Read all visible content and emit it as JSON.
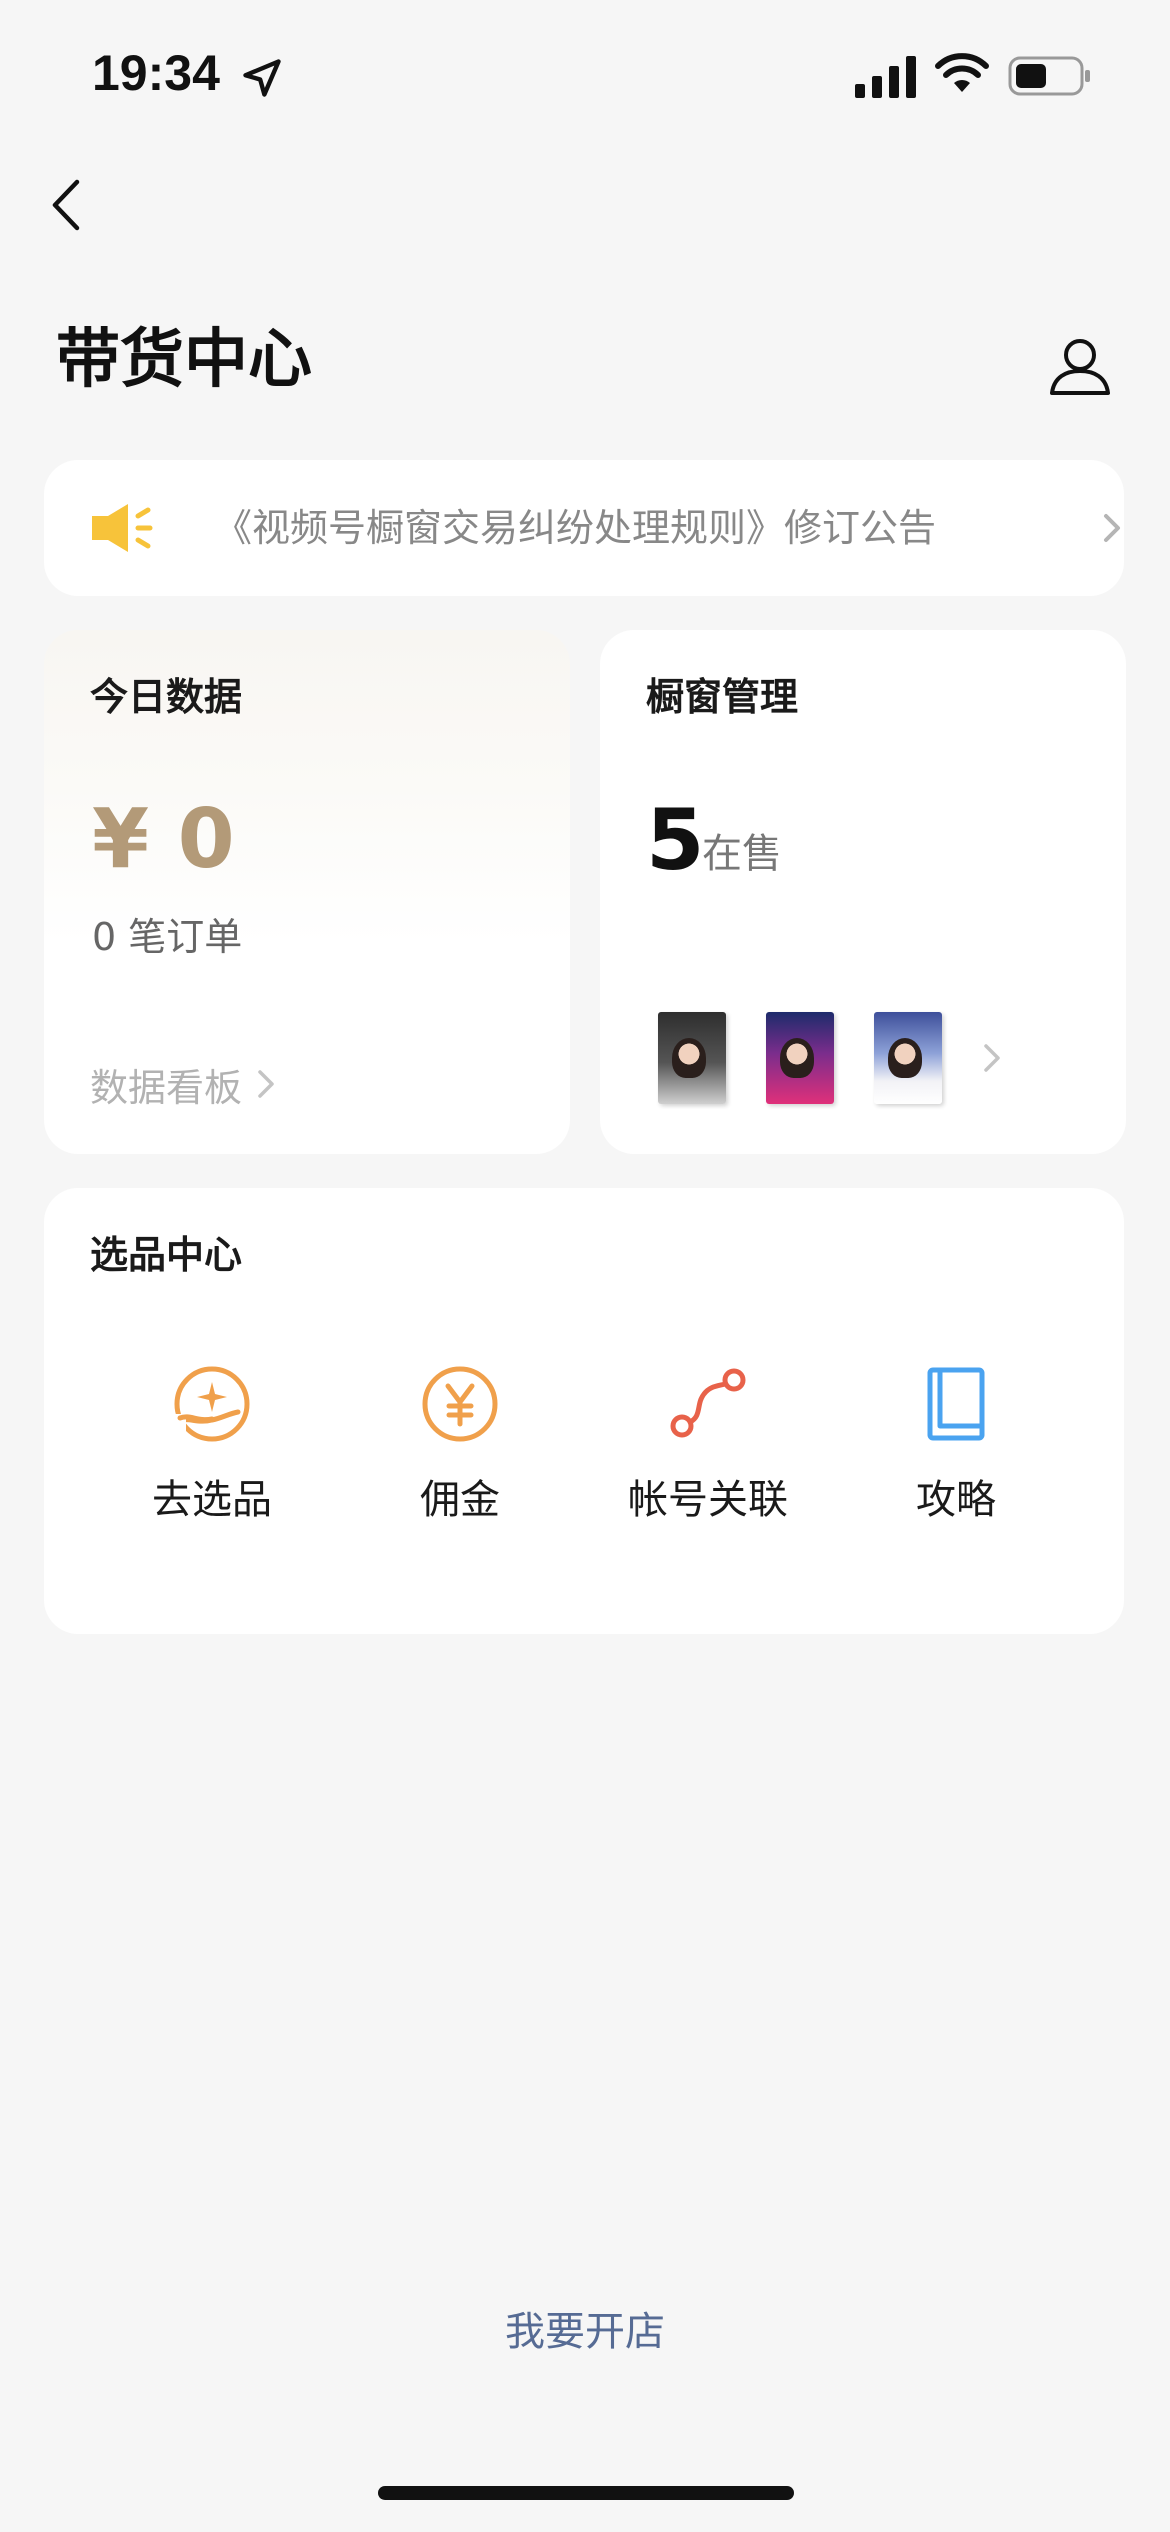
{
  "status_bar": {
    "time": "19:34"
  },
  "header": {
    "title": "带货中心"
  },
  "notice": {
    "text": "《视频号橱窗交易纠纷处理规则》修订公告"
  },
  "today_card": {
    "title": "今日数据",
    "amount": "¥ 0",
    "orders": "0 笔订单",
    "dashboard_link": "数据看板"
  },
  "showcase_card": {
    "title": "橱窗管理",
    "count": "5",
    "count_label": "在售"
  },
  "selection_center": {
    "title": "选品中心",
    "tools": [
      {
        "label": "去选品",
        "icon": "hand-sparkle-icon"
      },
      {
        "label": "佣金",
        "icon": "yuan-circle-icon"
      },
      {
        "label": "帐号关联",
        "icon": "link-path-icon"
      },
      {
        "label": "攻略",
        "icon": "book-icon"
      }
    ]
  },
  "footer": {
    "open_store": "我要开店"
  },
  "colors": {
    "background": "#f6f6f6",
    "money": "#b39a78",
    "orange": "#f0a04b",
    "red": "#e8624a",
    "blue": "#4aa3f0",
    "link": "#566b94",
    "notice_icon": "#f7c33a"
  }
}
